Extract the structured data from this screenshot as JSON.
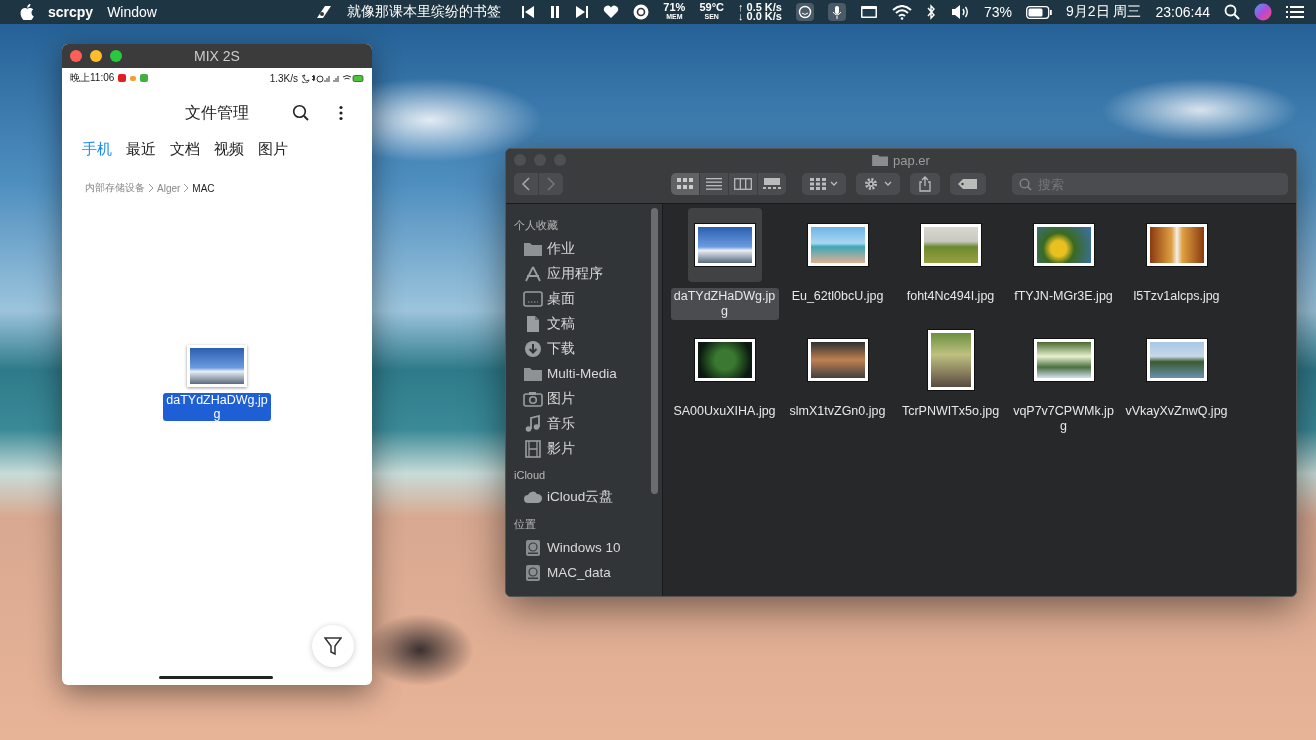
{
  "menu_bar": {
    "app_name": "scrcpy",
    "menus": [
      "Window"
    ],
    "song_title": "就像那课本里缤纷的书签",
    "mem": {
      "value": "71%",
      "label": "MEM"
    },
    "sensor": {
      "value": "59°C",
      "label": "SEN"
    },
    "net_up": "↑ 0.5 K/s",
    "net_down": "↓ 0.0 K/s",
    "battery": "73%",
    "date": "9月2日 周三",
    "time": "23:06:44"
  },
  "phone_window": {
    "title": "MIX 2S",
    "status_time": "晚上11:06",
    "net_speed": "1.3K/s",
    "app_title": "文件管理",
    "tabs": [
      {
        "label": "手机",
        "selected": true
      },
      {
        "label": "最近",
        "selected": false
      },
      {
        "label": "文档",
        "selected": false
      },
      {
        "label": "视频",
        "selected": false
      },
      {
        "label": "图片",
        "selected": false
      }
    ],
    "breadcrumb": [
      "内部存储设备",
      "Alger",
      "MAC"
    ],
    "files": [
      {
        "name": "daTYdZHaDWg.jpg",
        "selected": true
      }
    ]
  },
  "finder_window": {
    "title": "pap.er",
    "search": {
      "placeholder": "搜索"
    },
    "sidebar": [
      {
        "heading": "个人收藏",
        "items": [
          {
            "label": "作业",
            "kind": "folder"
          },
          {
            "label": "应用程序",
            "kind": "apps"
          },
          {
            "label": "桌面",
            "kind": "desktop"
          },
          {
            "label": "文稿",
            "kind": "document"
          },
          {
            "label": "下载",
            "kind": "download"
          },
          {
            "label": "Multi-Media",
            "kind": "folder"
          },
          {
            "label": "图片",
            "kind": "camera"
          },
          {
            "label": "音乐",
            "kind": "music"
          },
          {
            "label": "影片",
            "kind": "film"
          }
        ]
      },
      {
        "heading": "iCloud",
        "items": [
          {
            "label": "iCloud云盘",
            "kind": "cloud"
          }
        ]
      },
      {
        "heading": "位置",
        "items": [
          {
            "label": "Windows 10",
            "kind": "disk"
          },
          {
            "label": "MAC_data",
            "kind": "disk"
          }
        ]
      }
    ],
    "files": [
      {
        "name": "daTYdZHaDWg.jpg",
        "selected": true
      },
      {
        "name": "Eu_62tl0bcU.jpg",
        "selected": false
      },
      {
        "name": "foht4Nc494I.jpg",
        "selected": false
      },
      {
        "name": "fTYJN-MGr3E.jpg",
        "selected": false
      },
      {
        "name": "l5Tzv1alcps.jpg",
        "selected": false
      },
      {
        "name": "SA00UxuXIHA.jpg",
        "selected": false
      },
      {
        "name": "slmX1tvZGn0.jpg",
        "selected": false
      },
      {
        "name": "TcrPNWITx5o.jpg",
        "selected": false
      },
      {
        "name": "vqP7v7CPWMk.jpg",
        "selected": false
      },
      {
        "name": "vVkayXvZnwQ.jpg",
        "selected": false
      }
    ]
  }
}
